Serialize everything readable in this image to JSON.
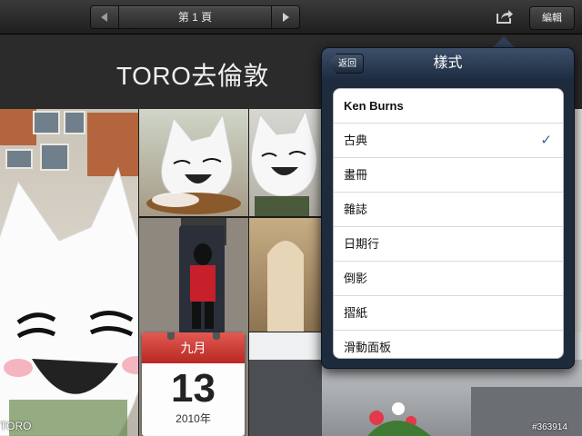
{
  "toolbar": {
    "page_label": "第 1 頁",
    "prev_icon": "chevron-left-icon",
    "next_icon": "chevron-right-icon",
    "share_icon": "share-icon",
    "edit_label": "編輯"
  },
  "album": {
    "title": "TORO去倫敦",
    "calendar": {
      "month": "九月",
      "day": "13",
      "year": "2010年"
    },
    "caption": "TORO"
  },
  "popover": {
    "back_label": "返回",
    "title": "樣式",
    "items": [
      {
        "label": "Ken Burns",
        "checked": false
      },
      {
        "label": "古典",
        "checked": true
      },
      {
        "label": "畫冊",
        "checked": false
      },
      {
        "label": "雜誌",
        "checked": false
      },
      {
        "label": "日期行",
        "checked": false
      },
      {
        "label": "倒影",
        "checked": false
      },
      {
        "label": "摺紙",
        "checked": false
      },
      {
        "label": "滑動面板",
        "checked": false
      }
    ],
    "check_glyph": "✓"
  },
  "watermark": "#363914",
  "colors": {
    "toolbar": "#2a2a2a",
    "popover_header": "#1e2b3d",
    "calendar_red": "#c9342e",
    "checkmark": "#3a5f9a"
  }
}
